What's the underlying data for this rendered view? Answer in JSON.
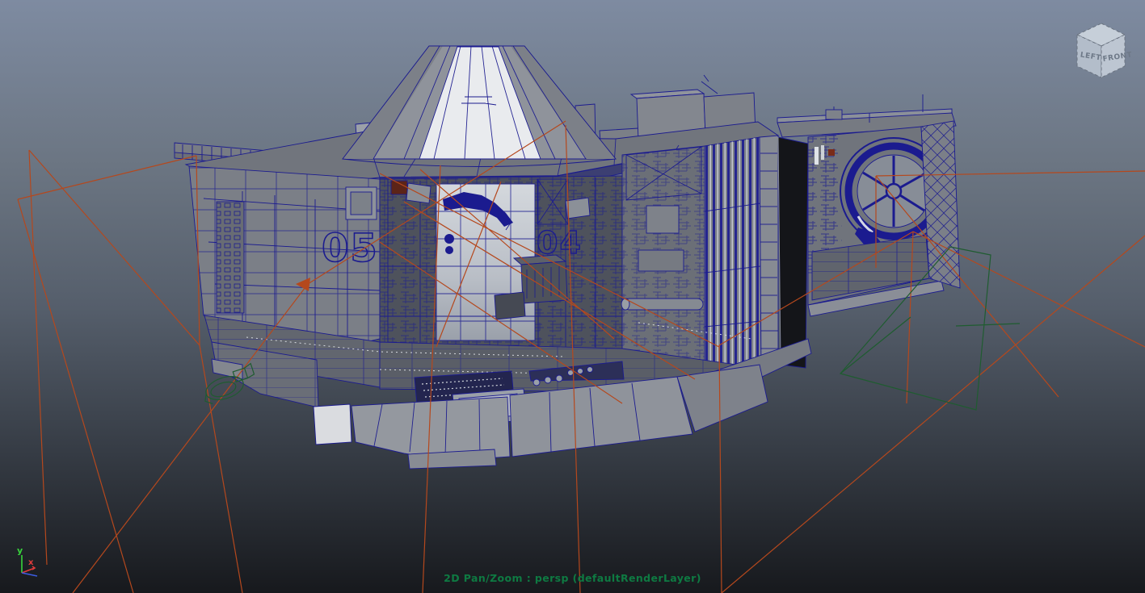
{
  "viewport": {
    "status_text": "2D Pan/Zoom : persp (defaultRenderLayer)"
  },
  "view_cube": {
    "left_face": "LEFT",
    "front_face": "FRONT"
  },
  "axis_gizmo": {
    "y": "y",
    "x": "x"
  },
  "model": {
    "wall_number_left": "05",
    "wall_number_right": "04"
  },
  "colors": {
    "bg_top": "#7e8ba1",
    "bg_mid": "#555e6b",
    "bg_bottom": "#17191d",
    "wireframe": "#1b1b8f",
    "frustum_orange": "#b5481d",
    "wire_green": "#1f5c30",
    "status_green": "#0e7a42",
    "axis_y_green": "#38d43c",
    "axis_x_red": "#e23c3c",
    "axis_z_blue": "#3c5ce2"
  }
}
